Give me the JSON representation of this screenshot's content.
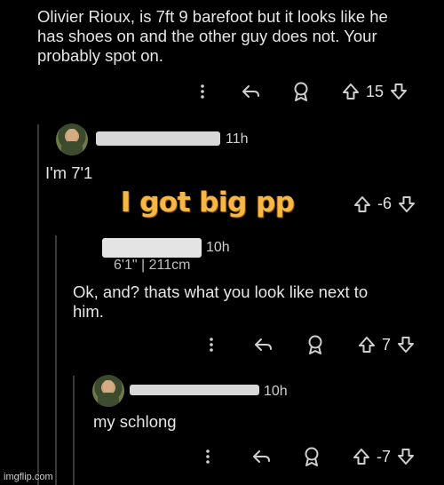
{
  "post1": {
    "text": "Olivier Rioux, is 7ft 9 barefoot but it looks like he\nhas shoes on and the other guy does not. Your\nprobably spot on.",
    "vote_count": "15"
  },
  "reply1": {
    "timestamp": "11h",
    "text": "I'm 7'1",
    "vote_count": "-6"
  },
  "meme_caption": "I got big pp",
  "reply2": {
    "timestamp": "10h",
    "flair": "6'1\" | 211cm",
    "text": "Ok, and? thats what you look like next to\nhim.",
    "vote_count": "7"
  },
  "reply3": {
    "timestamp": "10h",
    "text": "my schlong",
    "vote_count": "-7"
  },
  "watermark": "imgflip.com",
  "colors": {
    "background": "#000000",
    "text": "#e6e6e6",
    "caption": "#f7b744",
    "thread_line": "#3a3a3a"
  },
  "icons": {
    "more": "more-vertical-icon",
    "reply": "reply-arrow-icon",
    "award": "award-icon",
    "upvote": "upvote-arrow-icon",
    "downvote": "downvote-arrow-icon"
  }
}
